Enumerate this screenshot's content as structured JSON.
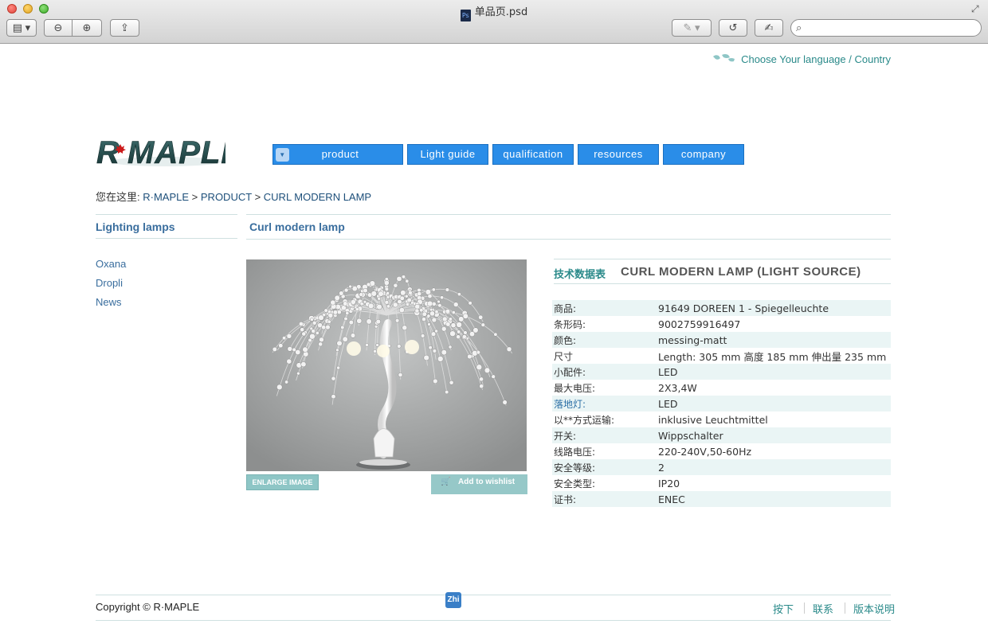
{
  "window": {
    "title": "单品页.psd",
    "ps_icon_label": "Ps",
    "search_placeholder": ""
  },
  "toolbar": {
    "sidebar_icon": "sidebar-toggle-icon",
    "zoom_out_icon": "zoom-out-icon",
    "zoom_in_icon": "zoom-in-icon",
    "share_icon": "share-icon",
    "annotate_icon": "annotate-icon",
    "rotate_icon": "rotate-icon",
    "edit_icon": "edit-icon"
  },
  "header": {
    "language_link": "Choose Your language / Country",
    "logo_text": "R·MAPLE"
  },
  "nav": {
    "items": [
      {
        "label": "product"
      },
      {
        "label": "Light guide"
      },
      {
        "label": "qualification"
      },
      {
        "label": "resources"
      },
      {
        "label": "company"
      }
    ]
  },
  "breadcrumb": {
    "prefix": "您在这里:",
    "items": [
      "R·MAPLE",
      "PRODUCT",
      "CURL MODERN LAMP"
    ],
    "sep": ">"
  },
  "sidebar": {
    "title": "Lighting lamps",
    "items": [
      {
        "label": "Oxana"
      },
      {
        "label": "Dropli"
      },
      {
        "label": "News"
      }
    ]
  },
  "main": {
    "title": "Curl modern lamp",
    "enlarge_label": "ENLARGE IMAGE",
    "wishlist_label": "Add to wishlist"
  },
  "specs": {
    "heading_cn": "技术数据表",
    "heading_en": "CURL MODERN LAMP (LIGHT SOURCE)",
    "rows": [
      {
        "key": "商品:",
        "value": "91649 DOREEN 1 - Spiegelleuchte"
      },
      {
        "key": "条形码:",
        "value": "9002759916497"
      },
      {
        "key": "颜色:",
        "value": "messing-matt"
      },
      {
        "key": "尺寸",
        "value": "Length: 305 mm 高度 185 mm 伸出量 235 mm"
      },
      {
        "key": "小配件:",
        "value": "LED"
      },
      {
        "key": "最大电压:",
        "value": "2X3,4W"
      },
      {
        "key": "落地灯:",
        "value": "LED"
      },
      {
        "key": "以**方式运输:",
        "value": "inklusive Leuchtmittel"
      },
      {
        "key": "开关:",
        "value": "Wippschalter"
      },
      {
        "key": "线路电压:",
        "value": "220-240V,50-60Hz"
      },
      {
        "key": "安全等级:",
        "value": "2"
      },
      {
        "key": "安全类型:",
        "value": "IP20"
      },
      {
        "key": "证书:",
        "value": "ENEC"
      }
    ]
  },
  "footer": {
    "copyright": "Copyright © R·MAPLE",
    "badge": "Zhi",
    "links": [
      {
        "label": "按下"
      },
      {
        "label": "联系"
      },
      {
        "label": "版本说明"
      }
    ]
  },
  "colors": {
    "nav_blue": "#2a8de8",
    "accent_teal": "#2a8a8a",
    "link_blue": "#3a6e9e",
    "row_tint": "#eaf5f5"
  }
}
